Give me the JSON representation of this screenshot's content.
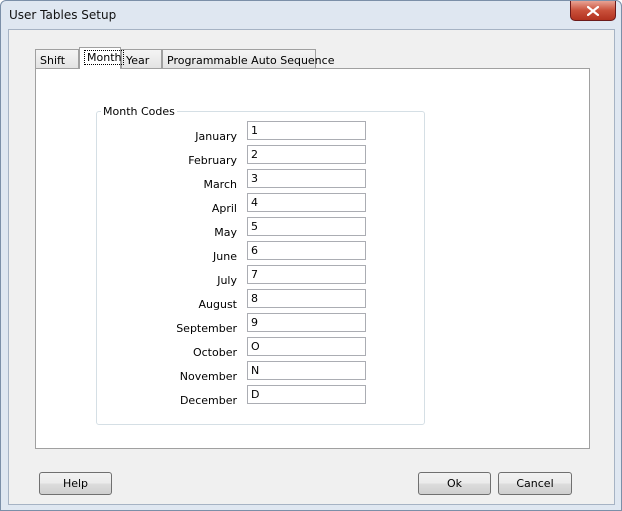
{
  "window": {
    "title": "User Tables Setup"
  },
  "tabs": [
    {
      "label": "Shift"
    },
    {
      "label": "Month"
    },
    {
      "label": "Year"
    },
    {
      "label": "Programmable Auto Sequence"
    }
  ],
  "group": {
    "label": "Month Codes",
    "rows": [
      {
        "month": "January",
        "code": "1"
      },
      {
        "month": "February",
        "code": "2"
      },
      {
        "month": "March",
        "code": "3"
      },
      {
        "month": "April",
        "code": "4"
      },
      {
        "month": "May",
        "code": "5"
      },
      {
        "month": "June",
        "code": "6"
      },
      {
        "month": "July",
        "code": "7"
      },
      {
        "month": "August",
        "code": "8"
      },
      {
        "month": "September",
        "code": "9"
      },
      {
        "month": "October",
        "code": "O"
      },
      {
        "month": "November",
        "code": "N"
      },
      {
        "month": "December",
        "code": "D"
      }
    ]
  },
  "buttons": {
    "help": "Help",
    "ok": "Ok",
    "cancel": "Cancel"
  }
}
